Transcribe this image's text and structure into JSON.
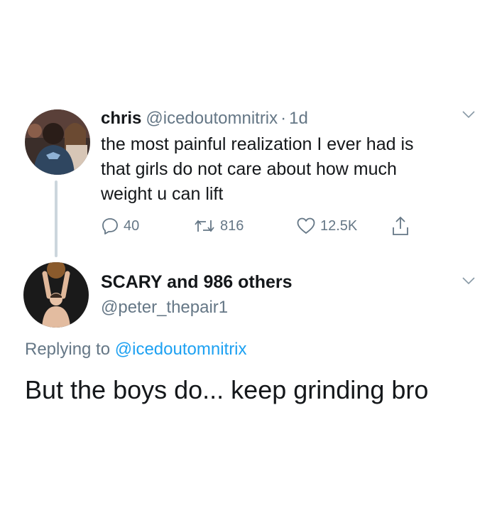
{
  "tweet1": {
    "display_name": "chris",
    "handle": "@icedoutomnitrix",
    "separator": "·",
    "time": "1d",
    "text_lines": [
      "the most painful realization I ever had is",
      "that girls do not care about how much",
      "weight u can lift"
    ],
    "replies_count": "40",
    "retweets_count": "816",
    "likes_count": "12.5K",
    "avatar_icon": "user-photo-avatar"
  },
  "tweet2": {
    "display_name": "SCARY and 986 others",
    "handle": "@peter_thepair1",
    "replying_prefix": "Replying to",
    "replying_handle": "@icedoutomnitrix",
    "text": "But the boys do... keep grinding bro",
    "avatar_icon": "user-photo-avatar"
  },
  "colors": {
    "text": "#14171a",
    "muted": "#657786",
    "link": "#1da1f2",
    "thread_line": "#ccd6dd",
    "background": "#ffffff"
  }
}
